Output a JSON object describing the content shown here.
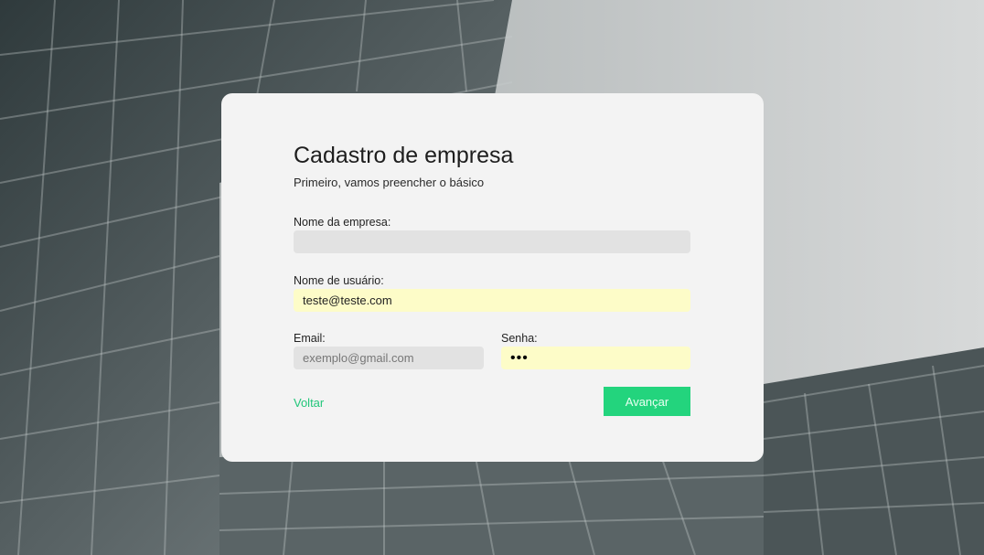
{
  "form": {
    "title": "Cadastro de empresa",
    "subtitle": "Primeiro, vamos preencher o básico",
    "company_name": {
      "label": "Nome da empresa:",
      "value": ""
    },
    "username": {
      "label": "Nome de usuário:",
      "value": "teste@teste.com"
    },
    "email": {
      "label": "Email:",
      "placeholder": "exemplo@gmail.com",
      "value": ""
    },
    "password": {
      "label": "Senha:",
      "masked_value": "•••"
    },
    "back_label": "Voltar",
    "next_label": "Avançar"
  },
  "colors": {
    "accent": "#23d47d",
    "card_bg": "#f3f3f3",
    "input_bg": "#e2e2e2",
    "autofill_bg": "#fdfcc8"
  }
}
